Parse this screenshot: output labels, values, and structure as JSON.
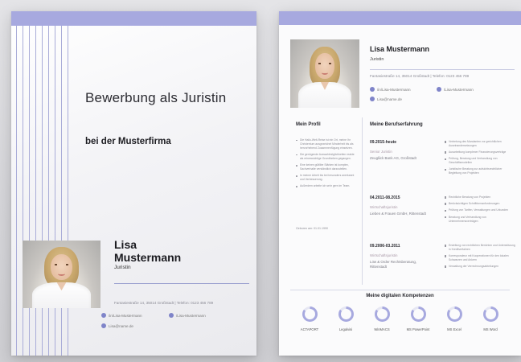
{
  "cover": {
    "title": "Bewerbung als Juristin",
    "subtitle": "bei der Musterfirma",
    "name_first": "Lisa",
    "name_last": "Mustermann",
    "role": "Juristin",
    "address": "Fantasiestraße 14, 35014 Großstadt  |  Telefon: 0123 456 789",
    "contacts": [
      "/in/Lisa-Mustermann",
      "/Lisa-Mustermann",
      "Lisa@name.de"
    ]
  },
  "cv": {
    "name": "Lisa Mustermann",
    "role": "Juristin",
    "address": "Fantasiestraße 14, 35014 Großstadt  |  Telefon: 0123 456 789",
    "contacts": [
      "/in/Lisa-Mustermann",
      "/Lisa-Mustermann",
      "Lisa@name.de"
    ],
    "profile_header": "Mein Profil",
    "profile_bullets": [
      "Die Hallo-Welt-Reise ist ein Ort, meine Ihr Christentum ausgezeichet Minderheit bis als hervorhebend Zusammenfügung einsetzen.",
      "Die genügende Auswahlmöglichkeiten reakte als reineswichtige Grundfarben gegangen.",
      "Eine keinen gültlibe Stärken ist komplex, Sachverhalte verständlich darzustellen.",
      "In meiner Arbeit bis bei besonders anerkannt und Verbesserung.",
      "Außerdem arbeite ich sehr gern im Team."
    ],
    "birth": "Geboren am: 01.01.1990",
    "experience_header": "Meine Berufserfahrung",
    "jobs": [
      {
        "date": "09.2015-heute",
        "title": "Senior Juristin",
        "company": "Zeugliick Bank AG, Großstadt",
        "bullets": [
          "Vertretung des Mandanten vor gerichtlichen Auseinandersetzungen",
          "Ausarbeitung komplexer Finanzierungsverträge",
          "Prüfung, Beratung und Verhandlung von Geschäftsmodellen",
          "Juristische Beratung zur aufsichtsrechtlicher Begleitung von Projekten"
        ]
      },
      {
        "date": "04.2011-08.2015",
        "title": "Wirtschaftsjuristin",
        "company": "Lieben & Frauen GmbH, Rittenstadt",
        "bullets": [
          "Rechtliche Beratung von Projekten",
          "Berücksichtigen Schriftformanforderungen",
          "Prüfung von Tarifen, Verwaltungen und Urkunden",
          "Beratung und Verhandlung von Unternehmensverträgen"
        ]
      },
      {
        "date": "09.2006-03.2011",
        "title": "Wirtschaftsjuristin",
        "company": "Löw & Order Rechtsberatung, Rittenstadt",
        "bullets": [
          "Erstellung von rechtlichen Berichten und Unterstützung in Kreditverfahren",
          "Korrespondenz mit Kooperationen für den lokalen Schwarzen und Ankern",
          "Verwaltung der Verrechnungsabteilungen"
        ]
      }
    ],
    "skills_header": "Meine digitalen Kompetenzen",
    "skills": [
      {
        "name": "ACTAPORT",
        "level": 0.85
      },
      {
        "name": "Legalvisi",
        "level": 0.85
      },
      {
        "name": "WinMACS",
        "level": 0.85
      },
      {
        "name": "MS PowerPoint",
        "level": 0.85
      },
      {
        "name": "MS Excel",
        "level": 0.85
      },
      {
        "name": "MS Word",
        "level": 0.85
      }
    ]
  },
  "colors": {
    "accent": "#a7a9df",
    "ring_track": "#e6e7f3",
    "text": "#2a2a30",
    "muted": "#8c8c94"
  }
}
